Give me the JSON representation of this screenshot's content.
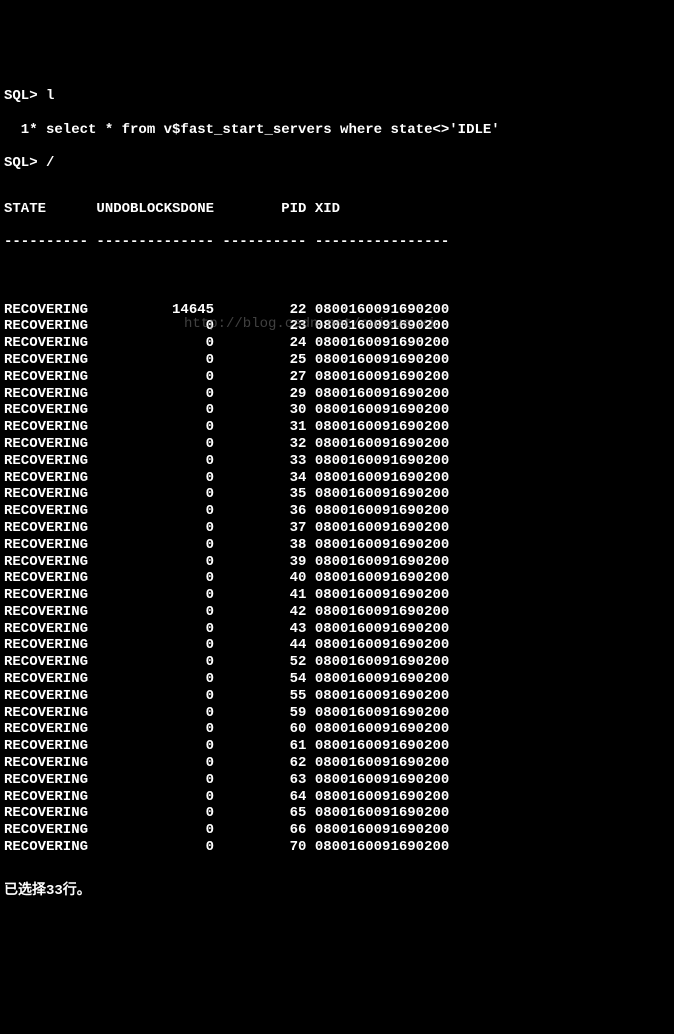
{
  "prompt1": "SQL> l",
  "query_line": "  1* select * from v$fast_start_servers where state<>'IDLE'",
  "prompt2": "SQL> /",
  "headers": {
    "state": "STATE",
    "undoblocksdone": "UNDOBLOCKSDONE",
    "pid": "PID",
    "xid": "XID"
  },
  "divider": "---------- -------------- ---------- ----------------",
  "rows": [
    {
      "state": "RECOVERING",
      "undo": "14645",
      "pid": "22",
      "xid": "0800160091690200"
    },
    {
      "state": "RECOVERING",
      "undo": "0",
      "pid": "23",
      "xid": "0800160091690200"
    },
    {
      "state": "RECOVERING",
      "undo": "0",
      "pid": "24",
      "xid": "0800160091690200"
    },
    {
      "state": "RECOVERING",
      "undo": "0",
      "pid": "25",
      "xid": "0800160091690200"
    },
    {
      "state": "RECOVERING",
      "undo": "0",
      "pid": "27",
      "xid": "0800160091690200"
    },
    {
      "state": "RECOVERING",
      "undo": "0",
      "pid": "29",
      "xid": "0800160091690200"
    },
    {
      "state": "RECOVERING",
      "undo": "0",
      "pid": "30",
      "xid": "0800160091690200"
    },
    {
      "state": "RECOVERING",
      "undo": "0",
      "pid": "31",
      "xid": "0800160091690200"
    },
    {
      "state": "RECOVERING",
      "undo": "0",
      "pid": "32",
      "xid": "0800160091690200"
    },
    {
      "state": "RECOVERING",
      "undo": "0",
      "pid": "33",
      "xid": "0800160091690200"
    },
    {
      "state": "RECOVERING",
      "undo": "0",
      "pid": "34",
      "xid": "0800160091690200"
    },
    {
      "state": "RECOVERING",
      "undo": "0",
      "pid": "35",
      "xid": "0800160091690200"
    },
    {
      "state": "RECOVERING",
      "undo": "0",
      "pid": "36",
      "xid": "0800160091690200"
    },
    {
      "state": "RECOVERING",
      "undo": "0",
      "pid": "37",
      "xid": "0800160091690200"
    },
    {
      "state": "RECOVERING",
      "undo": "0",
      "pid": "38",
      "xid": "0800160091690200"
    },
    {
      "state": "RECOVERING",
      "undo": "0",
      "pid": "39",
      "xid": "0800160091690200"
    },
    {
      "state": "RECOVERING",
      "undo": "0",
      "pid": "40",
      "xid": "0800160091690200"
    },
    {
      "state": "RECOVERING",
      "undo": "0",
      "pid": "41",
      "xid": "0800160091690200"
    },
    {
      "state": "RECOVERING",
      "undo": "0",
      "pid": "42",
      "xid": "0800160091690200"
    },
    {
      "state": "RECOVERING",
      "undo": "0",
      "pid": "43",
      "xid": "0800160091690200"
    },
    {
      "state": "RECOVERING",
      "undo": "0",
      "pid": "44",
      "xid": "0800160091690200"
    },
    {
      "state": "RECOVERING",
      "undo": "0",
      "pid": "52",
      "xid": "0800160091690200"
    },
    {
      "state": "RECOVERING",
      "undo": "0",
      "pid": "54",
      "xid": "0800160091690200"
    },
    {
      "state": "RECOVERING",
      "undo": "0",
      "pid": "55",
      "xid": "0800160091690200"
    },
    {
      "state": "RECOVERING",
      "undo": "0",
      "pid": "59",
      "xid": "0800160091690200"
    },
    {
      "state": "RECOVERING",
      "undo": "0",
      "pid": "60",
      "xid": "0800160091690200"
    },
    {
      "state": "RECOVERING",
      "undo": "0",
      "pid": "61",
      "xid": "0800160091690200"
    },
    {
      "state": "RECOVERING",
      "undo": "0",
      "pid": "62",
      "xid": "0800160091690200"
    },
    {
      "state": "RECOVERING",
      "undo": "0",
      "pid": "63",
      "xid": "0800160091690200"
    },
    {
      "state": "RECOVERING",
      "undo": "0",
      "pid": "64",
      "xid": "0800160091690200"
    },
    {
      "state": "RECOVERING",
      "undo": "0",
      "pid": "65",
      "xid": "0800160091690200"
    },
    {
      "state": "RECOVERING",
      "undo": "0",
      "pid": "66",
      "xid": "0800160091690200"
    },
    {
      "state": "RECOVERING",
      "undo": "0",
      "pid": "70",
      "xid": "0800160091690200"
    }
  ],
  "footer": "已选择33行。",
  "watermark": "http://blog.csdn.net/cuixue_xi"
}
